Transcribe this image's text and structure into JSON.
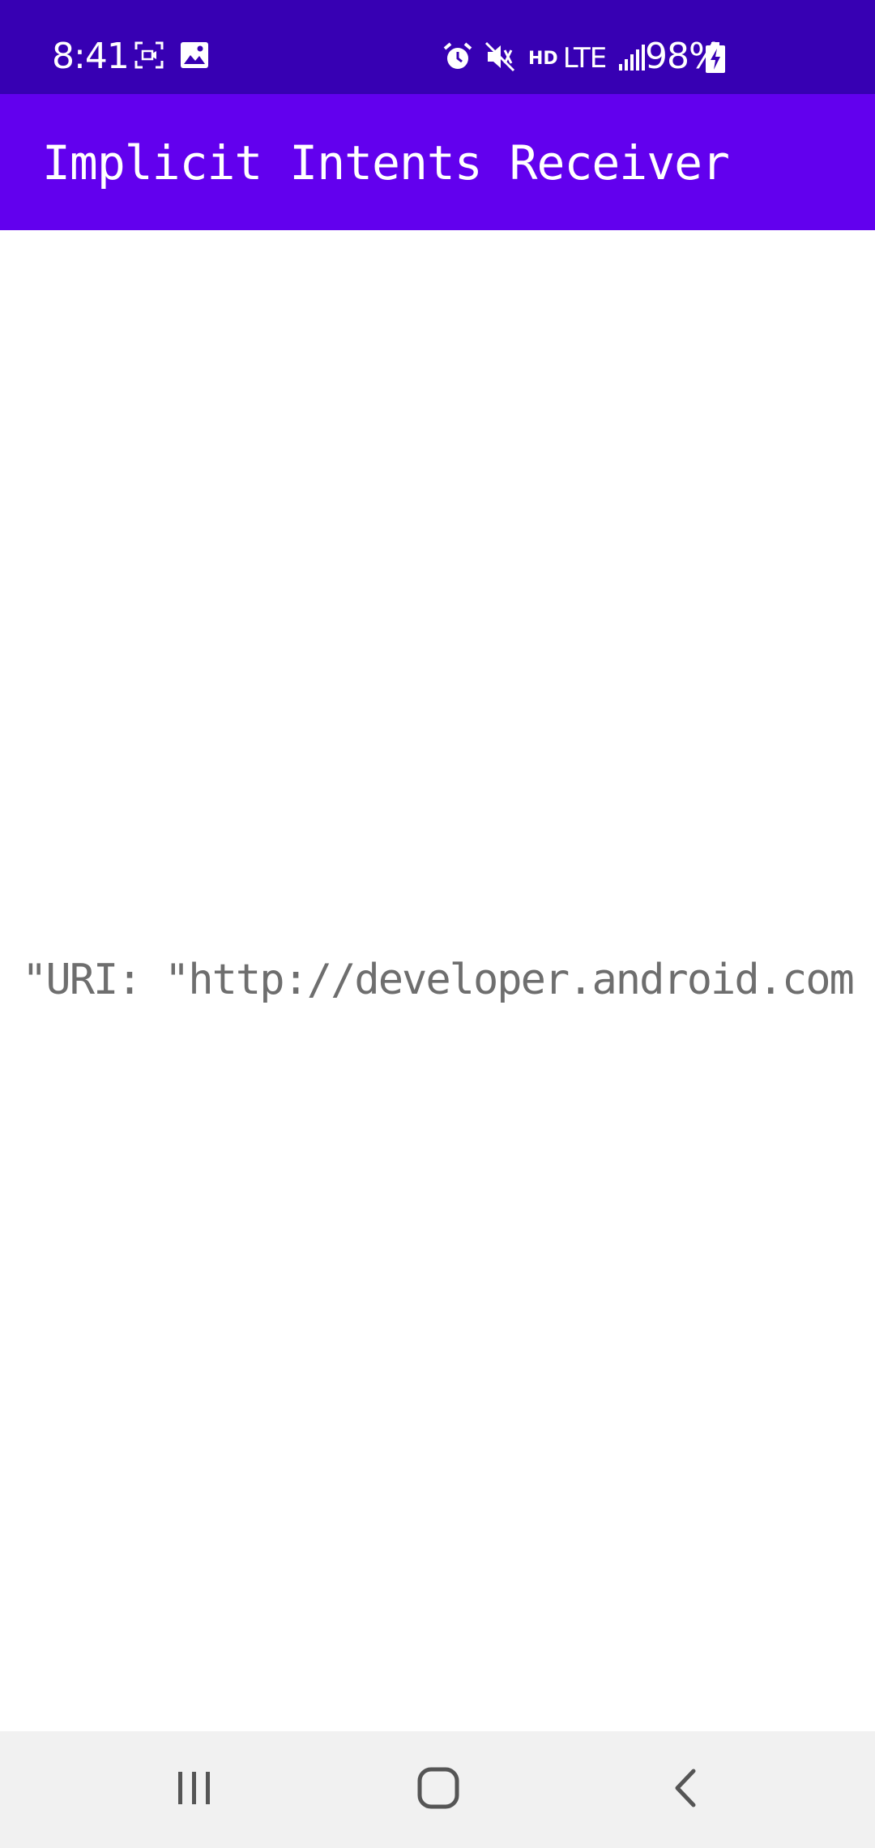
{
  "status_bar": {
    "time": "8:41",
    "battery": "98%",
    "network": "LTE",
    "hd": "HD",
    "left_icons": [
      "screen-record-icon",
      "image-icon"
    ],
    "right_icons": [
      "alarm-icon",
      "mute-icon",
      "signal-icon",
      "battery-charging-icon"
    ],
    "background": "#3700B3"
  },
  "app_bar": {
    "title": "Implicit Intents Receiver",
    "background": "#6200EE"
  },
  "content": {
    "uri_text": "\"URI: \"http://developer.android.com"
  },
  "nav_bar": {
    "buttons": [
      "recent-apps-icon",
      "home-icon",
      "back-icon"
    ]
  }
}
